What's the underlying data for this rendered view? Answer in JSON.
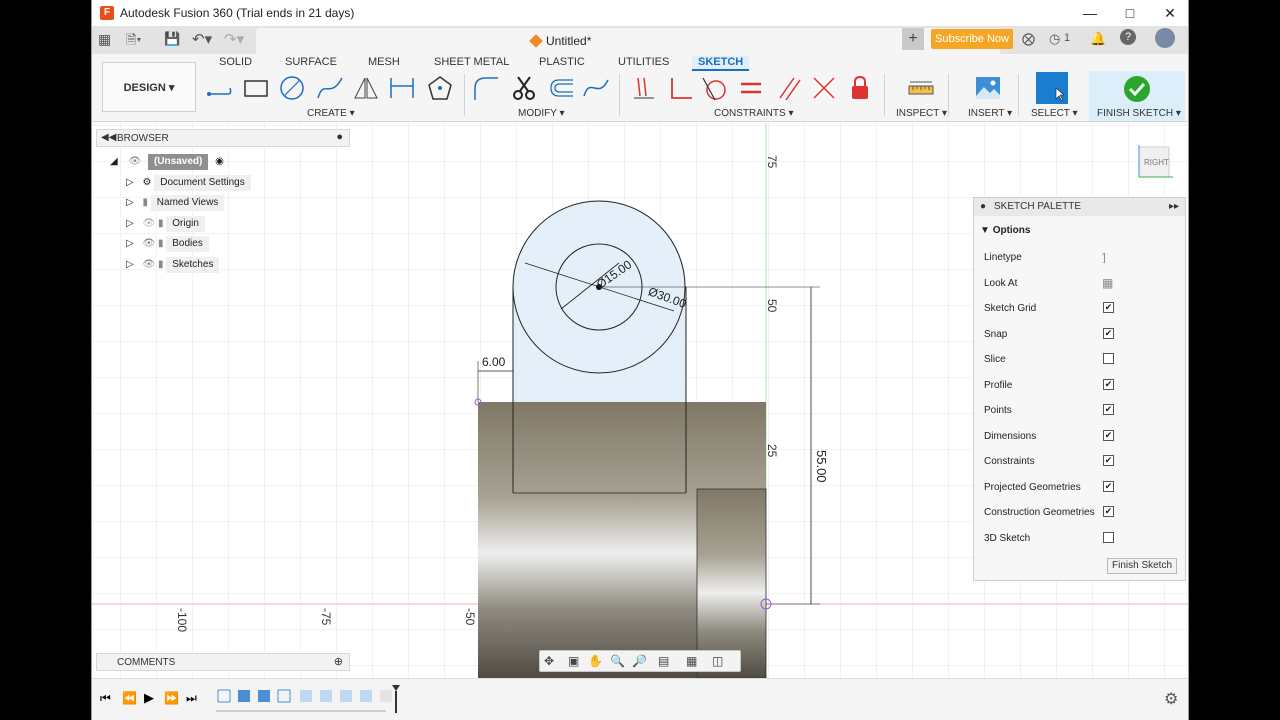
{
  "window": {
    "title": "Autodesk Fusion 360 (Trial ends in 21 days)",
    "app_icon": "F"
  },
  "tabbar": {
    "doc_title": "Untitled*",
    "subscribe_label": "Subscribe Now",
    "jobs_count": "1"
  },
  "toolbar": {
    "design_label": "DESIGN",
    "workspace_tabs": [
      "SOLID",
      "SURFACE",
      "MESH",
      "SHEET METAL",
      "PLASTIC",
      "UTILITIES",
      "SKETCH"
    ],
    "active_tab": "SKETCH",
    "groups": {
      "create": "CREATE",
      "modify": "MODIFY",
      "constraints": "CONSTRAINTS",
      "inspect": "INSPECT",
      "insert": "INSERT",
      "select": "SELECT",
      "finish": "FINISH SKETCH"
    }
  },
  "browser": {
    "title": "BROWSER",
    "root": "(Unsaved)",
    "items": [
      "Document Settings",
      "Named Views",
      "Origin",
      "Bodies",
      "Sketches"
    ]
  },
  "comments": {
    "title": "COMMENTS"
  },
  "viewcube": {
    "face": "RIGHT"
  },
  "canvas": {
    "dimensions": {
      "inner_diameter": "Ø15.00",
      "outer_diameter": "Ø30.00",
      "offset": "6.00",
      "height": "55.00"
    },
    "axis_labels": [
      "75",
      "50",
      "25",
      "-100",
      "-75",
      "-50"
    ]
  },
  "palette": {
    "title": "SKETCH PALETTE",
    "section": "Options",
    "rows": [
      {
        "label": "Linetype",
        "type": "icon"
      },
      {
        "label": "Look At",
        "type": "icon"
      },
      {
        "label": "Sketch Grid",
        "type": "check",
        "checked": true
      },
      {
        "label": "Snap",
        "type": "check",
        "checked": true
      },
      {
        "label": "Slice",
        "type": "check",
        "checked": false
      },
      {
        "label": "Profile",
        "type": "check",
        "checked": true
      },
      {
        "label": "Points",
        "type": "check",
        "checked": true
      },
      {
        "label": "Dimensions",
        "type": "check",
        "checked": true
      },
      {
        "label": "Constraints",
        "type": "check",
        "checked": true
      },
      {
        "label": "Projected Geometries",
        "type": "check",
        "checked": true
      },
      {
        "label": "Construction Geometries",
        "type": "check",
        "checked": true
      },
      {
        "label": "3D Sketch",
        "type": "check",
        "checked": false
      }
    ],
    "finish_label": "Finish Sketch"
  },
  "colors": {
    "accent": "#1a6fc2",
    "subscribe": "#f5a623",
    "finish_green": "#2aa62a",
    "grid": "#e6e6e6"
  }
}
